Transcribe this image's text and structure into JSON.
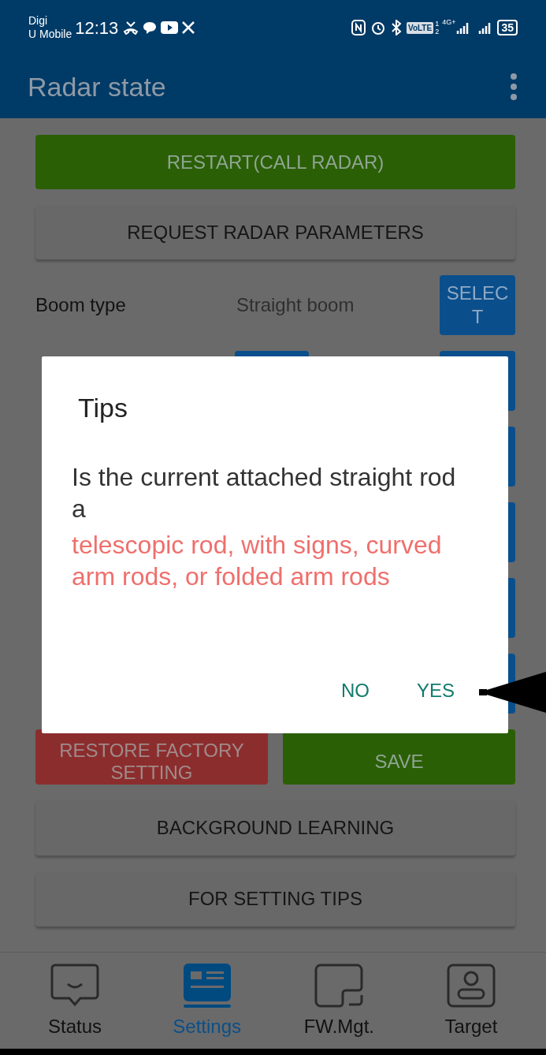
{
  "status_bar": {
    "carrier_lines": [
      "Digi",
      "U Mobile"
    ],
    "time": "12:13",
    "volte": "VoLTE",
    "sim_slots": [
      "1",
      "2"
    ],
    "network": "4G+",
    "battery": "35"
  },
  "app_bar": {
    "title": "Radar state"
  },
  "top_buttons": [
    {
      "label": "RESTART(CALL RADAR)",
      "kind": "green"
    },
    {
      "label": "REQUEST RADAR PARAMETERS",
      "kind": "grey"
    }
  ],
  "boom_row": {
    "label": "Boom type",
    "value": "Straight boom",
    "button": "SELECT"
  },
  "hidden_rows": [
    {
      "middle_button": true
    },
    {
      "middle_button": false
    },
    {
      "middle_button": false
    },
    {
      "middle_button": false
    },
    {
      "middle_button": false
    }
  ],
  "action_buttons": [
    {
      "label": "RESTORE FACTORY SETTING",
      "kind": "red"
    },
    {
      "label": "SAVE",
      "kind": "green"
    }
  ],
  "bottom_buttons": [
    {
      "label": "BACKGROUND LEARNING",
      "kind": "grey"
    },
    {
      "label": "FOR SETTING TIPS",
      "kind": "grey"
    }
  ],
  "dialog": {
    "title": "Tips",
    "message": "Is the current attached straight rod a",
    "highlight": "telescopic rod, with signs, curved arm rods, or folded arm rods",
    "actions": [
      "NO",
      "YES"
    ]
  },
  "nav": [
    {
      "label": "Status",
      "kind": "status",
      "selected": false
    },
    {
      "label": "Settings",
      "kind": "settings",
      "selected": true
    },
    {
      "label": "FW.Mgt.",
      "kind": "firmware",
      "selected": false
    },
    {
      "label": "Target",
      "kind": "target",
      "selected": false
    }
  ]
}
